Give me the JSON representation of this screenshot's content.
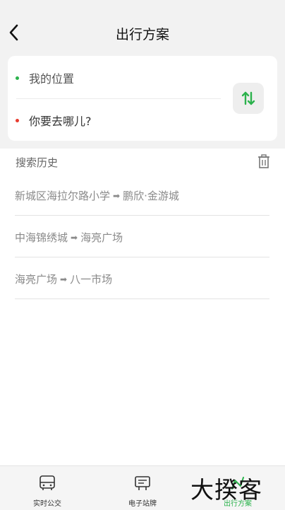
{
  "header": {
    "title": "出行方案"
  },
  "route_card": {
    "origin": "我的位置",
    "destination_placeholder": "你要去哪儿?"
  },
  "history": {
    "title": "搜索历史",
    "items": [
      {
        "from": "新城区海拉尔路小学",
        "to": "鹏欣·金游城"
      },
      {
        "from": "中海锦绣城",
        "to": "海亮广场"
      },
      {
        "from": "海亮广场",
        "to": "八一市场"
      }
    ]
  },
  "tabbar": {
    "tabs": [
      {
        "label": "实时公交",
        "icon": "bus-icon",
        "active": false
      },
      {
        "label": "电子站牌",
        "icon": "stop-sign-icon",
        "active": false
      },
      {
        "label": "出行方案",
        "icon": "route-icon",
        "active": true
      }
    ]
  },
  "watermark": "大揆客",
  "colors": {
    "accent": "#2bb24c",
    "destination_dot": "#e83b2e",
    "header_bg": "#f2f2f2"
  }
}
